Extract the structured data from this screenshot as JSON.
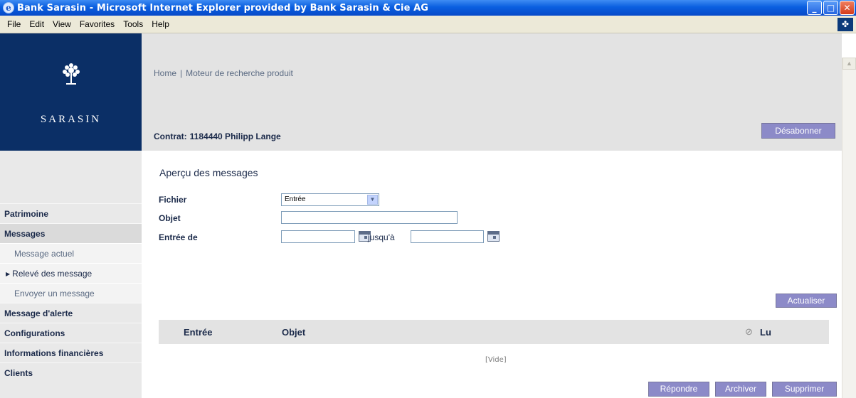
{
  "window": {
    "title": "Bank Sarasin - Microsoft Internet Explorer provided by Bank Sarasin & Cie AG",
    "controls": [
      "minimize",
      "maximize",
      "close"
    ]
  },
  "menubar": {
    "items": [
      "File",
      "Edit",
      "View",
      "Favorites",
      "Tools",
      "Help"
    ]
  },
  "brand": {
    "name": "SARASIN"
  },
  "header": {
    "breadcrumb": [
      "Home",
      "|",
      "Moteur de recherche produit"
    ],
    "contract_label": "Contrat:",
    "contract_value": "1184440 Philipp Lange",
    "unsubscribe_label": "Désabonner"
  },
  "sidebar": {
    "items": [
      {
        "label": "Patrimoine"
      },
      {
        "label": "Messages"
      },
      {
        "label": "Message actuel"
      },
      {
        "label": "Relevé des message"
      },
      {
        "label": "Envoyer un message"
      },
      {
        "label": "Message d'alerte"
      },
      {
        "label": "Configurations"
      },
      {
        "label": "Informations financières"
      },
      {
        "label": "Clients"
      }
    ]
  },
  "main": {
    "title": "Aperçu des messages",
    "filters": {
      "file_label": "Fichier",
      "file_value": "Entrée",
      "subject_label": "Objet",
      "subject_value": "",
      "received_label": "Entrée de",
      "from_value": "",
      "until_label": "jusqu'à",
      "to_value": ""
    },
    "refresh_label": "Actualiser",
    "table": {
      "columns": [
        "Entrée",
        "Objet",
        "Lu"
      ],
      "empty_text": "[Vide]"
    },
    "actions": {
      "reply": "Répondre",
      "archive": "Archiver",
      "delete": "Supprimer"
    }
  },
  "colors": {
    "brand_blue": "#0b2f66",
    "button_purple": "#8c8ac8",
    "band_gray": "#e3e3e3",
    "text_navy": "#1b2a4a"
  },
  "icons": [
    "ie-logo-icon",
    "minimize-icon",
    "maximize-icon",
    "close-icon",
    "sarasin-tree-icon",
    "dropdown-arrow-icon",
    "calendar-icon",
    "paperclip-icon",
    "scroll-up-arrow-icon",
    "bullet-arrow-icon"
  ]
}
